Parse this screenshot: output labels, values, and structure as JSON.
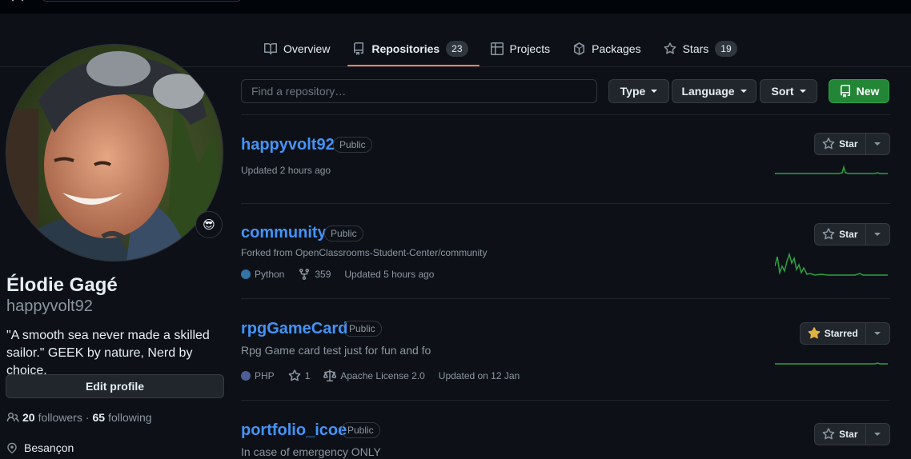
{
  "header": {
    "logo_icon": "github-logo-icon"
  },
  "tabs": [
    {
      "label": "Overview",
      "icon": "book-icon",
      "count": ""
    },
    {
      "label": "Repositories",
      "icon": "repo-icon",
      "count": "23"
    },
    {
      "label": "Projects",
      "icon": "table-icon",
      "count": ""
    },
    {
      "label": "Packages",
      "icon": "package-icon",
      "count": ""
    },
    {
      "label": "Stars",
      "icon": "star-icon",
      "count": "19"
    }
  ],
  "profile": {
    "full_name": "Élodie Gagé",
    "username": "happyvolt92",
    "status_emoji": "😎",
    "bio": "\"A smooth sea never made a skilled sailor.\" GEEK by nature, Nerd by choice.",
    "edit_label": "Edit profile",
    "followers_count": "20",
    "followers_label": "followers",
    "following_count": "65",
    "following_label": "following",
    "location": "Besançon"
  },
  "filters": {
    "search_placeholder": "Find a repository…",
    "type_label": "Type",
    "language_label": "Language",
    "sort_label": "Sort",
    "new_label": "New"
  },
  "repos": [
    {
      "name": "happyvolt92",
      "visibility": "Public",
      "description": "",
      "forked_from": "",
      "updated": "Updated 2 hours ago",
      "star_label": "Star",
      "starred": false
    },
    {
      "name": "community",
      "visibility": "Public",
      "forked_from": "Forked from OpenClassrooms-Student-Center/community",
      "language": "Python",
      "language_color": "#3572A5",
      "forks": "359",
      "updated": "Updated 5 hours ago",
      "star_label": "Star",
      "starred": false
    },
    {
      "name": "rpgGameCard",
      "visibility": "Public",
      "description": "Rpg Game card test just for fun and fo",
      "language": "PHP",
      "language_color": "#4F5D95",
      "stars": "1",
      "license": "Apache License 2.0",
      "updated": "Updated on 12 Jan",
      "star_label": "Starred",
      "starred": true
    },
    {
      "name": "portfolio_icoe",
      "visibility": "Public",
      "description": "In case of emergency ONLY",
      "star_label": "Star",
      "starred": false
    }
  ],
  "colors": {
    "accent_link": "#4493f8",
    "tab_underline": "#f78166",
    "new_button": "#238636",
    "sparkline": "#2ea043",
    "starred_star": "#e3b341"
  }
}
